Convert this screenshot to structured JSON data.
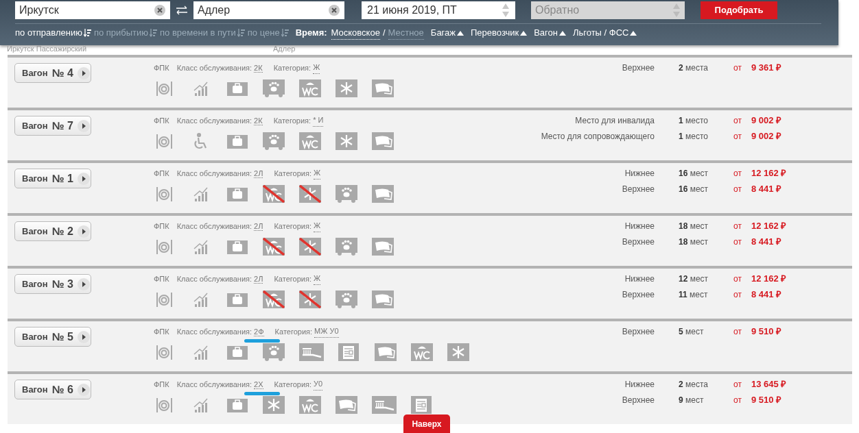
{
  "search": {
    "from": {
      "value": "Иркутск"
    },
    "to": {
      "value": "Адлер"
    },
    "date": {
      "value": "21 июня 2019, ПТ"
    },
    "return": {
      "placeholder": "Обратно",
      "disabled": true
    },
    "submit": "Подобрать"
  },
  "sort_options": [
    {
      "label": "по отправлению",
      "selected": true
    },
    {
      "label": "по прибытию",
      "selected": false
    },
    {
      "label": "по времени в пути",
      "selected": false
    },
    {
      "label": "по цене",
      "selected": false
    }
  ],
  "time": {
    "label": "Время:",
    "options": [
      {
        "label": "Московское",
        "selected": true
      },
      {
        "label": "Местное",
        "selected": false
      }
    ],
    "separator": "/"
  },
  "filters": [
    "Багаж",
    "Перевозчик",
    "Вагон",
    "Льготы / ФСС"
  ],
  "stations": {
    "departure": "Иркутск Пассажирский",
    "arrival": "Адлер"
  },
  "cars": [
    {
      "label": "Вагон",
      "number": "№ 4",
      "carrier": "ФПК",
      "class_label": "Класс обслуживания:",
      "class": "2К",
      "category_label": "Категория:",
      "category": "Ж",
      "marked": false,
      "icons": [
        {
          "kind": "food",
          "crossed": false
        },
        {
          "kind": "wifi",
          "crossed": false
        },
        {
          "kind": "bag",
          "crossed": false
        },
        {
          "kind": "pets",
          "crossed": false
        },
        {
          "kind": "wc",
          "crossed": false
        },
        {
          "kind": "ac",
          "crossed": false
        },
        {
          "kind": "linen",
          "crossed": false
        }
      ],
      "offers": [
        {
          "label": "Верхнее",
          "seats": "**2** места",
          "from": "от",
          "price": "9 361 ₽"
        }
      ]
    },
    {
      "label": "Вагон",
      "number": "№ 7",
      "carrier": "ФПК",
      "class_label": "Класс обслуживания:",
      "class": "2К",
      "category_label": "Категория:",
      "category": "* И",
      "marked": false,
      "icons": [
        {
          "kind": "food",
          "crossed": false
        },
        {
          "kind": "accessible",
          "crossed": false
        },
        {
          "kind": "bag",
          "crossed": false
        },
        {
          "kind": "pets",
          "crossed": false
        },
        {
          "kind": "wc",
          "crossed": false
        },
        {
          "kind": "ac",
          "crossed": false
        },
        {
          "kind": "linen",
          "crossed": false
        }
      ],
      "offers": [
        {
          "label": "Место для инвалида",
          "seats": "**1** место",
          "from": "от",
          "price": "9 002 ₽"
        },
        {
          "label": "Место для сопровождающего",
          "seats": "**1** место",
          "from": "от",
          "price": "9 002 ₽"
        }
      ]
    },
    {
      "label": "Вагон",
      "number": "№ 1",
      "carrier": "ФПК",
      "class_label": "Класс обслуживания:",
      "class": "2Л",
      "category_label": "Категория:",
      "category": "Ж",
      "marked": false,
      "icons": [
        {
          "kind": "food",
          "crossed": false
        },
        {
          "kind": "wifi",
          "crossed": false
        },
        {
          "kind": "bag",
          "crossed": false
        },
        {
          "kind": "wc",
          "crossed": true
        },
        {
          "kind": "ac",
          "crossed": true
        },
        {
          "kind": "pets",
          "crossed": false
        },
        {
          "kind": "linen",
          "crossed": false
        }
      ],
      "offers": [
        {
          "label": "Нижнее",
          "seats": "**16** мест",
          "from": "от",
          "price": "12 162 ₽"
        },
        {
          "label": "Верхнее",
          "seats": "**16** мест",
          "from": "от",
          "price": "8 441 ₽"
        }
      ]
    },
    {
      "label": "Вагон",
      "number": "№ 2",
      "carrier": "ФПК",
      "class_label": "Класс обслуживания:",
      "class": "2Л",
      "category_label": "Категория:",
      "category": "Ж",
      "marked": false,
      "icons": [
        {
          "kind": "food",
          "crossed": false
        },
        {
          "kind": "wifi",
          "crossed": false
        },
        {
          "kind": "bag",
          "crossed": false
        },
        {
          "kind": "wc",
          "crossed": true
        },
        {
          "kind": "ac",
          "crossed": true
        },
        {
          "kind": "pets",
          "crossed": false
        },
        {
          "kind": "linen",
          "crossed": false
        }
      ],
      "offers": [
        {
          "label": "Нижнее",
          "seats": "**18** мест",
          "from": "от",
          "price": "12 162 ₽"
        },
        {
          "label": "Верхнее",
          "seats": "**18** мест",
          "from": "от",
          "price": "8 441 ₽"
        }
      ]
    },
    {
      "label": "Вагон",
      "number": "№ 3",
      "carrier": "ФПК",
      "class_label": "Класс обслуживания:",
      "class": "2Л",
      "category_label": "Категория:",
      "category": "Ж",
      "marked": false,
      "icons": [
        {
          "kind": "food",
          "crossed": false
        },
        {
          "kind": "wifi",
          "crossed": false
        },
        {
          "kind": "bag",
          "crossed": false
        },
        {
          "kind": "wc",
          "crossed": true
        },
        {
          "kind": "ac",
          "crossed": true
        },
        {
          "kind": "pets",
          "crossed": false
        },
        {
          "kind": "linen",
          "crossed": false
        }
      ],
      "offers": [
        {
          "label": "Нижнее",
          "seats": "**12** мест",
          "from": "от",
          "price": "12 162 ₽"
        },
        {
          "label": "Верхнее",
          "seats": "**11** мест",
          "from": "от",
          "price": "8 441 ₽"
        }
      ]
    },
    {
      "label": "Вагон",
      "number": "№ 5",
      "carrier": "ФПК",
      "class_label": "Класс обслуживания:",
      "class": "2Ф",
      "category_label": "Категория:",
      "category": "МЖ У0",
      "marked": true,
      "icons": [
        {
          "kind": "food",
          "crossed": false
        },
        {
          "kind": "wifi",
          "crossed": false
        },
        {
          "kind": "bag",
          "crossed": false
        },
        {
          "kind": "pets",
          "crossed": false
        },
        {
          "kind": "toiletries",
          "crossed": false
        },
        {
          "kind": "press",
          "crossed": false
        },
        {
          "kind": "linen",
          "crossed": false
        },
        {
          "kind": "wc",
          "crossed": false
        },
        {
          "kind": "ac",
          "crossed": false
        }
      ],
      "offers": [
        {
          "label": "Верхнее",
          "seats": "**5** мест",
          "from": "от",
          "price": "9 510 ₽"
        }
      ]
    },
    {
      "label": "Вагон",
      "number": "№ 6",
      "carrier": "ФПК",
      "class_label": "Класс обслуживания:",
      "class": "2Х",
      "category_label": "Категория:",
      "category": "У0",
      "marked": true,
      "icons": [
        {
          "kind": "food",
          "crossed": false
        },
        {
          "kind": "wifi",
          "crossed": false
        },
        {
          "kind": "bag",
          "crossed": false
        },
        {
          "kind": "ac",
          "crossed": false
        },
        {
          "kind": "wc",
          "crossed": false
        },
        {
          "kind": "linen",
          "crossed": false
        },
        {
          "kind": "toiletries",
          "crossed": false
        },
        {
          "kind": "press",
          "crossed": false
        }
      ],
      "offers": [
        {
          "label": "Нижнее",
          "seats": "**2** места",
          "from": "от",
          "price": "13 645 ₽"
        },
        {
          "label": "Верхнее",
          "seats": "**9** мест",
          "from": "от",
          "price": "9 510 ₽"
        }
      ]
    }
  ],
  "scroll_top": "Наверх"
}
